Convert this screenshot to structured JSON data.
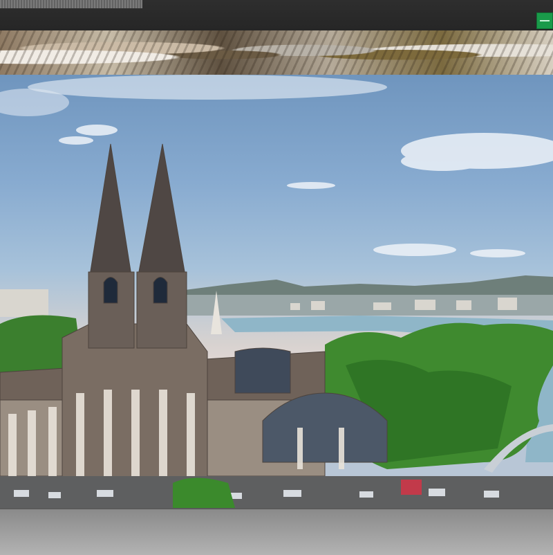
{
  "window": {
    "title_text": "",
    "action_button_icon": "minimize-icon"
  },
  "banner": {
    "content": "rock-texture-banner"
  },
  "photo": {
    "subject": "cathedral-city-river-landscape"
  },
  "colors": {
    "titlebar": "#2a2a2a",
    "accent_green": "#1a9a4a",
    "sky": "#88abd0",
    "foliage": "#3f8a2f",
    "river": "#8fb6c8",
    "bottom_bar": "#a3a3a3"
  }
}
